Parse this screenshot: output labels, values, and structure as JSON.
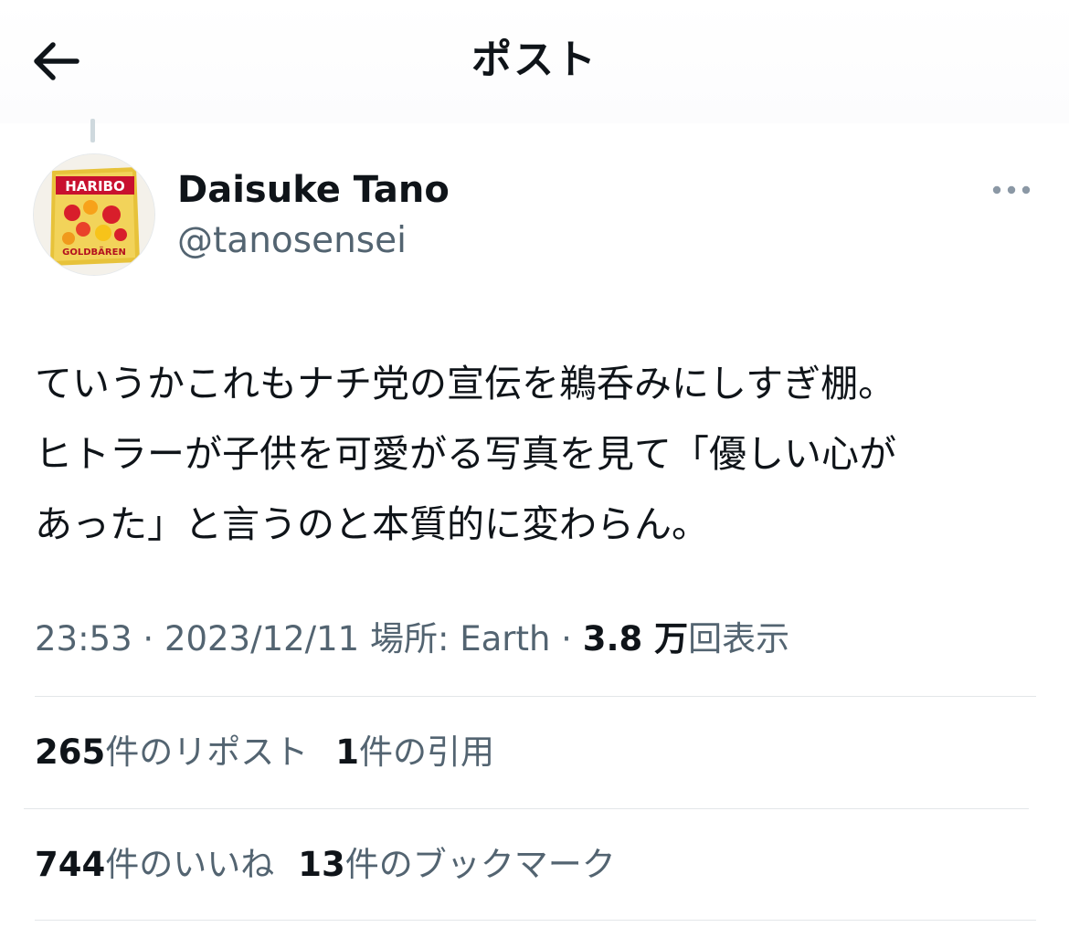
{
  "header": {
    "title": "ポスト",
    "back_icon": "arrow-left-icon"
  },
  "post": {
    "author": {
      "display_name": "Daisuke Tano",
      "handle": "@tanosensei",
      "avatar_text_top": "HARIBO",
      "avatar_text_bottom": "GOLDBÄREN"
    },
    "more_icon": "more-dots-icon",
    "text_lines": [
      "ていうかこれもナチ党の宣伝を鵜呑みにしすぎ棚。",
      "ヒトラーが子供を可愛がる写真を見て「優しい心が",
      "あった」と言うのと本質的に変わらん。"
    ],
    "meta": {
      "time": "23:53",
      "separator": " · ",
      "date": "2023/12/11",
      "location_label": "場所: Earth",
      "views_count": "3.8 万",
      "views_label": "回表示"
    },
    "stats_row1": [
      {
        "count": "265",
        "label": "件のリポスト"
      },
      {
        "count": "1",
        "label": "件の引用"
      }
    ],
    "stats_row2": [
      {
        "count": "744",
        "label": "件のいいね"
      },
      {
        "count": "13",
        "label": "件のブックマーク"
      }
    ]
  },
  "colors": {
    "text_primary": "#0f1419",
    "text_secondary": "#536471",
    "divider": "#e3e6e9"
  }
}
